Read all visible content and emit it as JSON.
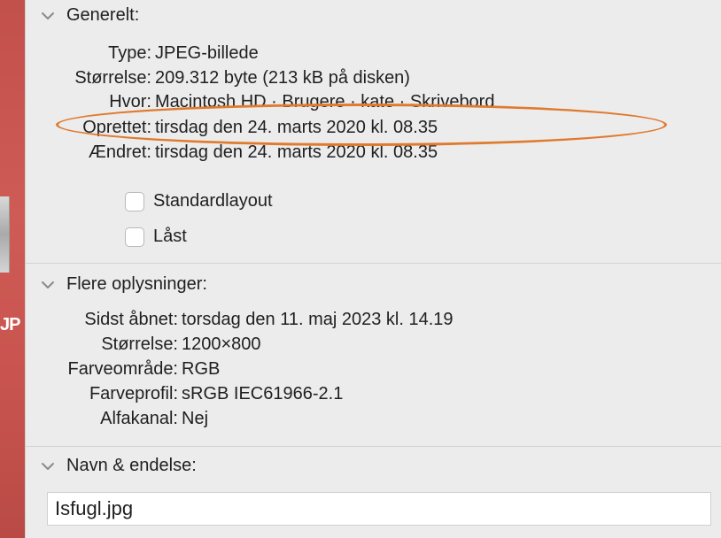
{
  "desktop": {
    "file_label_fragment": "JP"
  },
  "general": {
    "header": "Generelt:",
    "rows": [
      {
        "key": "Type:",
        "value": "JPEG-billede"
      },
      {
        "key": "Størrelse:",
        "value": "209.312 byte (213 kB på disken)"
      },
      {
        "key": "Hvor:",
        "value": "Macintosh HD · Brugere · kate · Skrivebord"
      },
      {
        "key": "Oprettet:",
        "value": "tirsdag den 24. marts 2020 kl. 08.35"
      },
      {
        "key": "Ændret:",
        "value": "tirsdag den 24. marts 2020 kl. 08.35"
      }
    ],
    "checkboxes": [
      {
        "label": "Standardlayout",
        "checked": false
      },
      {
        "label": "Låst",
        "checked": false
      }
    ]
  },
  "more_info": {
    "header": "Flere oplysninger:",
    "rows": [
      {
        "key": "Sidst åbnet:",
        "value": "torsdag den 11. maj 2023 kl. 14.19"
      },
      {
        "key": "Størrelse:",
        "value": "1200×800"
      },
      {
        "key": "Farveområde:",
        "value": "RGB"
      },
      {
        "key": "Farveprofil:",
        "value": "sRGB IEC61966-2.1"
      },
      {
        "key": "Alfakanal:",
        "value": "Nej"
      }
    ]
  },
  "name_ext": {
    "header": "Navn & endelse:",
    "value": "Isfugl.jpg"
  },
  "highlight": {
    "color": "#e07a2e"
  }
}
